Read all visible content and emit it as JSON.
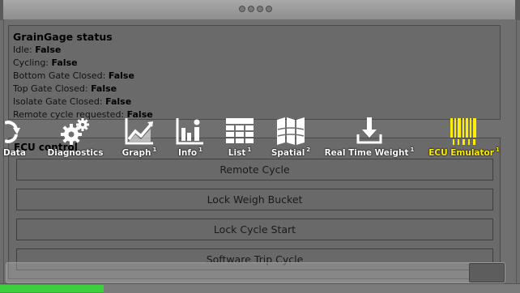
{
  "status": {
    "title": "GrainGage status",
    "rows": [
      {
        "label": "Idle: ",
        "value": "False"
      },
      {
        "label": "Cycling: ",
        "value": "False"
      },
      {
        "label": "Bottom Gate Closed: ",
        "value": "False"
      },
      {
        "label": "Top Gate Closed: ",
        "value": "False"
      },
      {
        "label": "Isolate Gate Closed: ",
        "value": "False"
      },
      {
        "label": "Remote cycle requested: ",
        "value": "False"
      }
    ]
  },
  "ecu": {
    "label": "ECU control",
    "buttons": [
      "Remote Cycle",
      "Lock Weigh Bucket",
      "Lock Cycle Start",
      "Software Trip Cycle"
    ]
  },
  "toolbar": {
    "items": [
      {
        "label": "Data",
        "badge": "",
        "icon": "refresh-icon"
      },
      {
        "label": "Diagnostics",
        "badge": "",
        "icon": "gears-icon"
      },
      {
        "label": "Graph",
        "badge": "1",
        "icon": "line-chart-icon"
      },
      {
        "label": "Info",
        "badge": "1",
        "icon": "info-icon"
      },
      {
        "label": "List",
        "badge": "1",
        "icon": "table-icon"
      },
      {
        "label": "Spatial",
        "badge": "2",
        "icon": "map-icon"
      },
      {
        "label": "Real Time Weight",
        "badge": "1",
        "icon": "download-scale-icon"
      },
      {
        "label": "ECU Emulator",
        "badge": "1",
        "icon": "barcode-icon"
      }
    ],
    "active": "ECU Emulator"
  },
  "colors": {
    "active_label": "#ffee00",
    "progress": "#3ecf3e"
  },
  "progress_fraction": 0.2
}
